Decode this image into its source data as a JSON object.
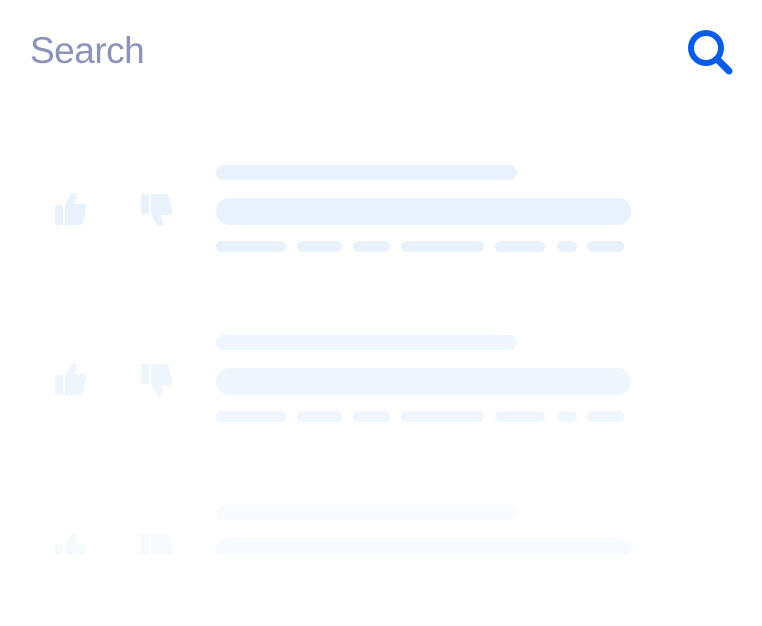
{
  "search": {
    "placeholder": "Search",
    "value": "",
    "button_icon": "search-icon",
    "accent": "#0a5ce6"
  },
  "results": {
    "state": "loading",
    "icons": {
      "like": "thumbs-up-icon",
      "dislike": "thumbs-down-icon"
    },
    "skeleton_color": "#e8f1fc"
  }
}
